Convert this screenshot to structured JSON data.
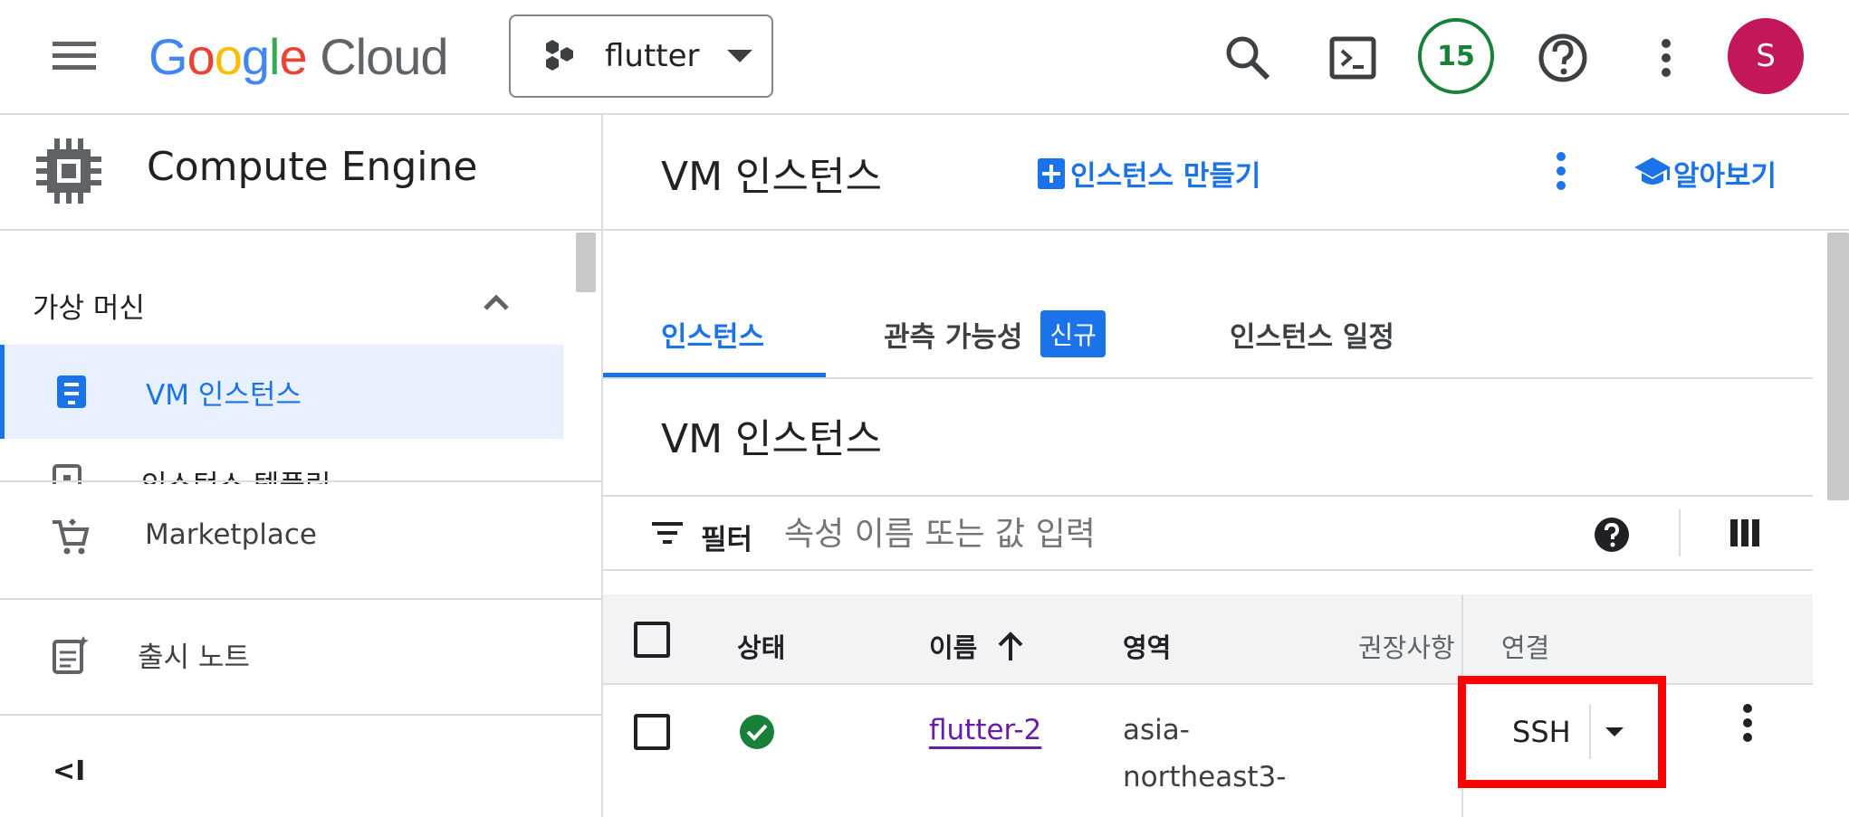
{
  "topbar": {
    "logo_google": "Google",
    "logo_cloud": "Cloud",
    "project_name": "flutter",
    "notification_count": "15",
    "avatar_letter": "S"
  },
  "sidebar": {
    "product_title": "Compute Engine",
    "section_title": "가상 머신",
    "items": [
      {
        "label": "VM 인스턴스"
      },
      {
        "label": "인스턴스 템플릿"
      }
    ],
    "marketplace_label": "Marketplace",
    "release_notes_label": "출시 노트",
    "collapse_label": "<I"
  },
  "header": {
    "title": "VM 인스턴스",
    "create_label": "인스턴스 만들기",
    "learn_label": "알아보기"
  },
  "tabs": [
    {
      "label": "인스턴스"
    },
    {
      "label": "관측 가능성",
      "badge": "신규"
    },
    {
      "label": "인스턴스 일정"
    }
  ],
  "section_title": "VM 인스턴스",
  "filter": {
    "label": "필터",
    "placeholder": "속성 이름 또는 값 입력"
  },
  "table": {
    "columns": [
      "상태",
      "이름",
      "영역",
      "권장사항",
      "연결"
    ],
    "rows": [
      {
        "name": "flutter-2",
        "zone_line1": "asia-",
        "zone_line2": "northeast3-",
        "connect": "SSH"
      }
    ]
  },
  "colors": {
    "accent": "#1a73e8",
    "highlight_border": "#ff0000",
    "status_ok": "#188038",
    "avatar_bg": "#c2185b"
  }
}
